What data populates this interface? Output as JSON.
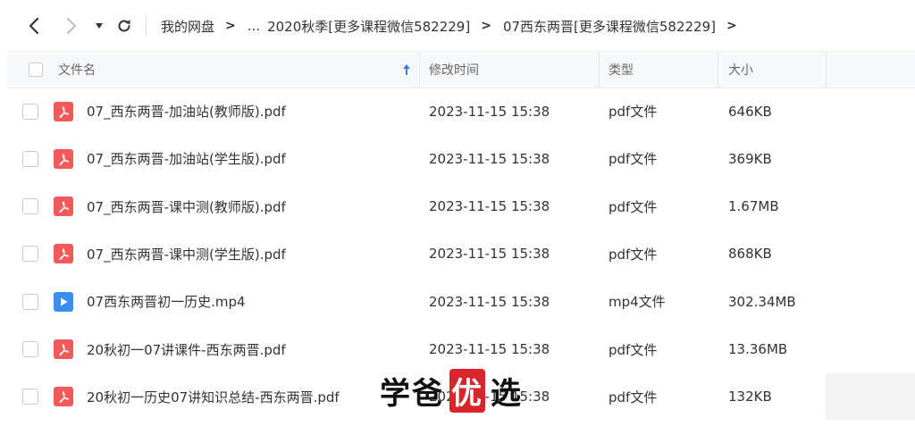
{
  "toolbar": {
    "icons": [
      "back-icon",
      "forward-icon",
      "dropdown-icon",
      "refresh-icon"
    ]
  },
  "breadcrumb": {
    "items": [
      "我的网盘",
      "...",
      "2020秋季[更多课程微信582229]",
      "07西东两晋[更多课程微信582229]"
    ],
    "separator": ">"
  },
  "table": {
    "columns": {
      "name": "文件名",
      "modified": "修改时间",
      "type": "类型",
      "size": "大小"
    },
    "sort_icon": "sort-up-arrow-icon",
    "rows": [
      {
        "name": "07_西东两晋-加油站(教师版).pdf",
        "modified": "2023-11-15 15:38",
        "type": "pdf文件",
        "size": "646KB",
        "icon": "pdf-icon"
      },
      {
        "name": "07_西东两晋-加油站(学生版).pdf",
        "modified": "2023-11-15 15:38",
        "type": "pdf文件",
        "size": "369KB",
        "icon": "pdf-icon"
      },
      {
        "name": "07_西东两晋-课中测(教师版).pdf",
        "modified": "2023-11-15 15:38",
        "type": "pdf文件",
        "size": "1.67MB",
        "icon": "pdf-icon"
      },
      {
        "name": "07_西东两晋-课中测(学生版).pdf",
        "modified": "2023-11-15 15:38",
        "type": "pdf文件",
        "size": "868KB",
        "icon": "pdf-icon"
      },
      {
        "name": "07西东两晋初一历史.mp4",
        "modified": "2023-11-15 15:38",
        "type": "mp4文件",
        "size": "302.34MB",
        "icon": "video-icon"
      },
      {
        "name": "20秋初一07讲课件-西东两晋.pdf",
        "modified": "2023-11-15 15:38",
        "type": "pdf文件",
        "size": "13.36MB",
        "icon": "pdf-icon"
      },
      {
        "name": "20秋初一历史07讲知识总结-西东两晋.pdf",
        "modified": "2023-11-15 15:38",
        "type": "pdf文件",
        "size": "132KB",
        "icon": "pdf-icon"
      }
    ]
  },
  "watermark": {
    "part1": "学爸",
    "part2": "优",
    "part3": "选"
  },
  "colors": {
    "pdf": "#f15a5a",
    "video": "#3a8ef0",
    "sort_arrow": "#2f7ff5",
    "header_bg": "#f7f8fa"
  }
}
